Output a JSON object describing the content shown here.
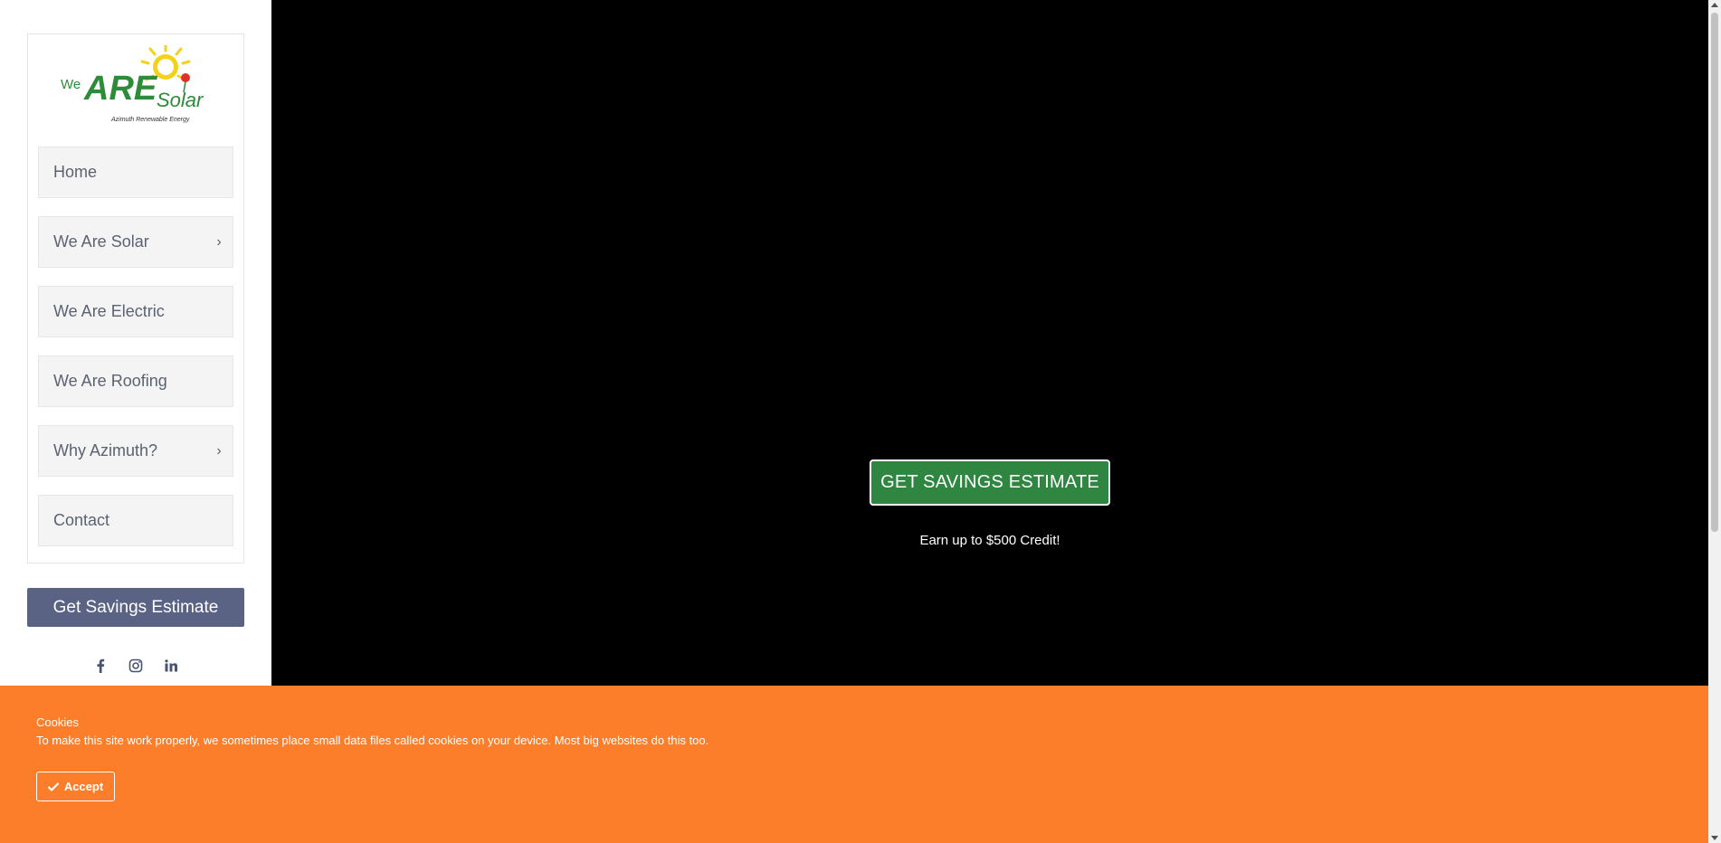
{
  "logo": {
    "alt": "We ARE Solar - Azimuth Renewable Energy",
    "word_we": "We",
    "word_are": "ARE",
    "word_solar": "Solar",
    "tagline": "Azimuth Renewable Energy",
    "colors": {
      "green": "#2e8b3a",
      "yellow": "#f2d21b",
      "red": "#e0312b"
    }
  },
  "sidebar": {
    "items": [
      {
        "label": "Home",
        "has_submenu": false
      },
      {
        "label": "We Are Solar",
        "has_submenu": true
      },
      {
        "label": "We Are Electric",
        "has_submenu": false
      },
      {
        "label": "We Are Roofing",
        "has_submenu": false
      },
      {
        "label": "Why Azimuth?",
        "has_submenu": true
      },
      {
        "label": "Contact",
        "has_submenu": false
      }
    ],
    "chevron": "›",
    "cta_label": "Get Savings Estimate",
    "socials": [
      {
        "name": "facebook-icon"
      },
      {
        "name": "instagram-icon"
      },
      {
        "name": "linkedin-icon"
      }
    ]
  },
  "hero": {
    "button_label": "GET SAVINGS ESTIMATE",
    "credit_text": "Earn up to $500 Credit!",
    "colors": {
      "background": "#000000",
      "button": "#2f8640"
    }
  },
  "cookie_banner": {
    "title": "Cookies",
    "text": "To make this site work properly, we sometimes place small data files called cookies on your device. Most big websites do this too.",
    "accept_label": "Accept",
    "color": "#fd7e2a"
  }
}
